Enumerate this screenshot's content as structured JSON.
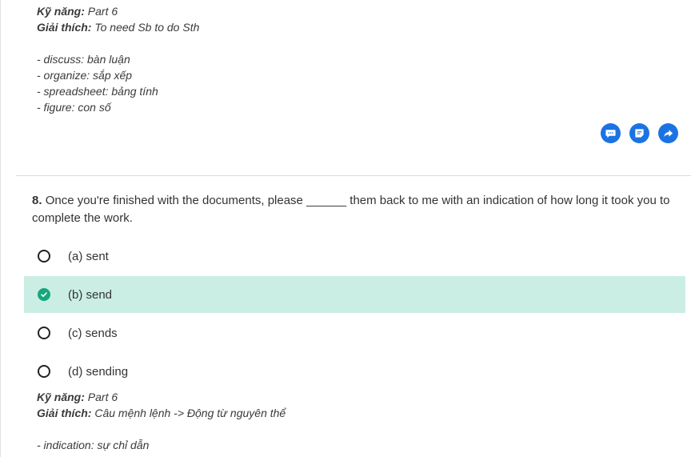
{
  "explanation_top": {
    "skill_label": "Kỹ năng:",
    "skill_value": "Part 6",
    "explain_label": "Giải thích:",
    "explain_value": "To need Sb to do Sth",
    "vocab": [
      "- discuss: bàn luận",
      "- organize: sắp xếp",
      "- spreadsheet: bảng tính",
      "- figure: con số"
    ]
  },
  "actions": {
    "comment_icon": "comment-icon",
    "note_icon": "note-icon",
    "share_icon": "share-icon",
    "color": "#1b73e3"
  },
  "question": {
    "number": "8.",
    "text": "Once you're finished with the documents, please ______ them back to me with an indication of how long it took you to complete the work."
  },
  "options": [
    {
      "label": "(a) sent",
      "selected": false
    },
    {
      "label": "(b) send",
      "selected": true
    },
    {
      "label": "(c) sends",
      "selected": false
    },
    {
      "label": "(d) sending",
      "selected": false
    }
  ],
  "selected_color": "#cbeee4",
  "check_color": "#16a77c",
  "explanation_bottom": {
    "skill_label": "Kỹ năng:",
    "skill_value": "Part 6",
    "explain_label": "Giải thích:",
    "explain_value": "Câu mệnh lệnh -> Động từ nguyên thể",
    "vocab": [
      "- indication: sự chỉ dẫn"
    ]
  }
}
